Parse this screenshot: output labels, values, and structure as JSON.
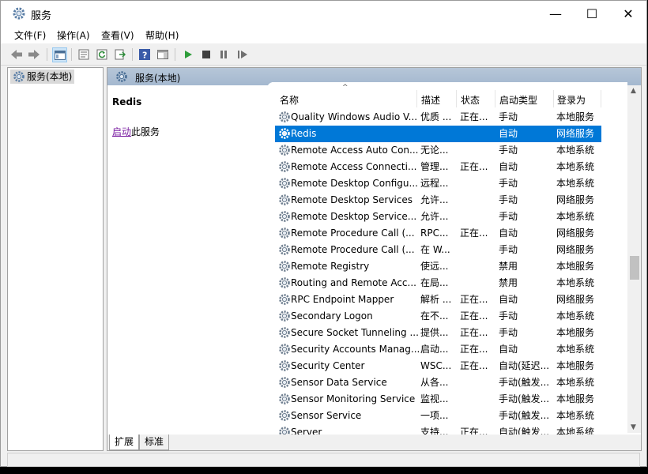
{
  "window": {
    "title": "服务",
    "min_label": "—",
    "max_label": "☐",
    "close_label": "✕"
  },
  "menu": [
    "文件(F)",
    "操作(A)",
    "查看(V)",
    "帮助(H)"
  ],
  "tree": {
    "root_label": "服务(本地)"
  },
  "pane": {
    "header": "服务(本地)",
    "selected_service": "Redis",
    "action_link": "启动",
    "action_suffix": "此服务"
  },
  "columns": [
    "名称",
    "描述",
    "状态",
    "启动类型",
    "登录为"
  ],
  "rows": [
    {
      "name": "Quality Windows Audio V...",
      "desc": "优质 ...",
      "status": "正在...",
      "startup": "手动",
      "logon": "本地服务"
    },
    {
      "name": "Redis",
      "desc": "",
      "status": "",
      "startup": "自动",
      "logon": "网络服务",
      "selected": true
    },
    {
      "name": "Remote Access Auto Con...",
      "desc": "无论...",
      "status": "",
      "startup": "手动",
      "logon": "本地系统"
    },
    {
      "name": "Remote Access Connecti...",
      "desc": "管理...",
      "status": "正在...",
      "startup": "自动",
      "logon": "本地系统"
    },
    {
      "name": "Remote Desktop Configu...",
      "desc": "远程...",
      "status": "",
      "startup": "手动",
      "logon": "本地系统"
    },
    {
      "name": "Remote Desktop Services",
      "desc": "允许...",
      "status": "",
      "startup": "手动",
      "logon": "网络服务"
    },
    {
      "name": "Remote Desktop Service...",
      "desc": "允许...",
      "status": "",
      "startup": "手动",
      "logon": "本地系统"
    },
    {
      "name": "Remote Procedure Call (...",
      "desc": "RPC...",
      "status": "正在...",
      "startup": "自动",
      "logon": "网络服务"
    },
    {
      "name": "Remote Procedure Call (...",
      "desc": "在 W...",
      "status": "",
      "startup": "手动",
      "logon": "网络服务"
    },
    {
      "name": "Remote Registry",
      "desc": "使远...",
      "status": "",
      "startup": "禁用",
      "logon": "本地服务"
    },
    {
      "name": "Routing and Remote Acc...",
      "desc": "在局...",
      "status": "",
      "startup": "禁用",
      "logon": "本地系统"
    },
    {
      "name": "RPC Endpoint Mapper",
      "desc": "解析 ...",
      "status": "正在...",
      "startup": "自动",
      "logon": "网络服务"
    },
    {
      "name": "Secondary Logon",
      "desc": "在不...",
      "status": "正在...",
      "startup": "手动",
      "logon": "本地系统"
    },
    {
      "name": "Secure Socket Tunneling ...",
      "desc": "提供...",
      "status": "正在...",
      "startup": "手动",
      "logon": "本地服务"
    },
    {
      "name": "Security Accounts Manag...",
      "desc": "启动...",
      "status": "正在...",
      "startup": "自动",
      "logon": "本地系统"
    },
    {
      "name": "Security Center",
      "desc": "WSC...",
      "status": "正在...",
      "startup": "自动(延迟...",
      "logon": "本地服务"
    },
    {
      "name": "Sensor Data Service",
      "desc": "从各...",
      "status": "",
      "startup": "手动(触发...",
      "logon": "本地系统"
    },
    {
      "name": "Sensor Monitoring Service",
      "desc": "监视...",
      "status": "",
      "startup": "手动(触发...",
      "logon": "本地服务"
    },
    {
      "name": "Sensor Service",
      "desc": "一项...",
      "status": "",
      "startup": "手动(触发...",
      "logon": "本地系统"
    },
    {
      "name": "Server",
      "desc": "支持...",
      "status": "正在...",
      "startup": "自动(触发...",
      "logon": "本地系统"
    }
  ],
  "tabs": [
    "扩展",
    "标准"
  ]
}
